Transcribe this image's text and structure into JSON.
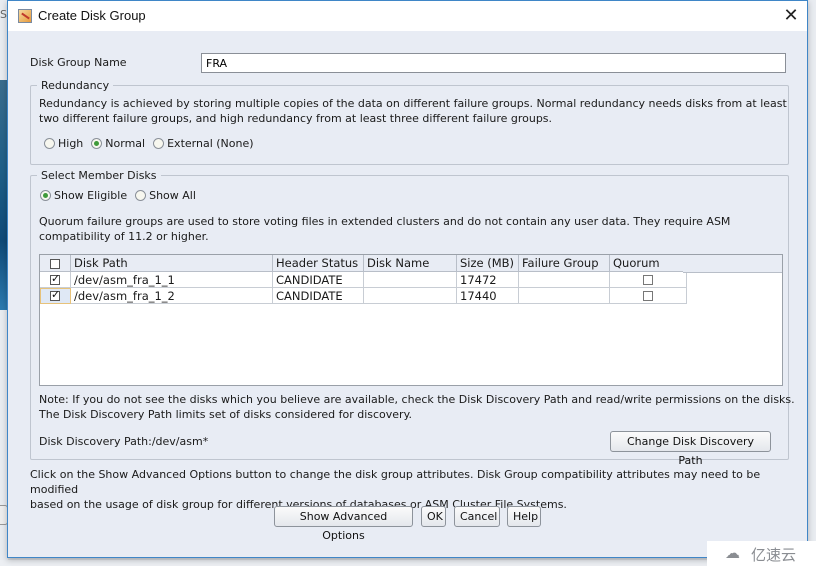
{
  "window": {
    "title": "Create Disk Group",
    "close_icon": "close-icon",
    "app_icon": "oracle-asmca-icon"
  },
  "disk_group_name": {
    "label": "Disk Group Name",
    "value": "FRA"
  },
  "redundancy": {
    "legend": "Redundancy",
    "description_line1": "Redundancy is achieved by storing multiple copies of the data on different failure groups. Normal redundancy needs disks from at least",
    "description_line2": "two different failure groups, and high redundancy from at least three different failure groups.",
    "options": [
      {
        "label": "High",
        "selected": false
      },
      {
        "label": "Normal",
        "selected": true
      },
      {
        "label": "External (None)",
        "selected": false
      }
    ]
  },
  "member_disks": {
    "legend": "Select Member Disks",
    "filter_options": [
      {
        "label": "Show Eligible",
        "selected": true
      },
      {
        "label": "Show All",
        "selected": false
      }
    ],
    "quorum_note_line1": "Quorum failure groups are used to store voting files in extended clusters and do not contain any user data. They require ASM",
    "quorum_note_line2": "compatibility of 11.2 or higher.",
    "table": {
      "columns": [
        "",
        "Disk Path",
        "Header Status",
        "Disk Name",
        "Size (MB)",
        "Failure Group",
        "Quorum"
      ],
      "select_all_checked": false,
      "rows": [
        {
          "selected": true,
          "disk_path": "/dev/asm_fra_1_1",
          "header_status": "CANDIDATE",
          "disk_name": "",
          "size_mb": "17472",
          "failure_group": "",
          "quorum": false
        },
        {
          "selected": true,
          "disk_path": "/dev/asm_fra_1_2",
          "header_status": "CANDIDATE",
          "disk_name": "",
          "size_mb": "17440",
          "failure_group": "",
          "quorum": false
        }
      ]
    },
    "note_line1": "Note: If you do not see the disks which you believe are available, check the Disk Discovery Path and read/write permissions on the disks.",
    "note_line2": "The Disk Discovery Path limits set of disks considered for discovery.",
    "discovery_path_label": "Disk Discovery Path:/dev/asm*",
    "change_path_button": "Change Disk Discovery Path"
  },
  "advanced_note_line1": "Click on the Show Advanced Options button to change the disk group attributes. Disk Group compatibility attributes may need to be modified",
  "advanced_note_line2": "based on the usage of disk group for different versions of databases or ASM Cluster File Systems.",
  "buttons": {
    "show_advanced": "Show Advanced Options",
    "ok": "OK",
    "cancel": "Cancel",
    "help": "Help"
  },
  "watermark": {
    "logo_icon": "cloud-logo-icon",
    "text": "亿速云"
  }
}
